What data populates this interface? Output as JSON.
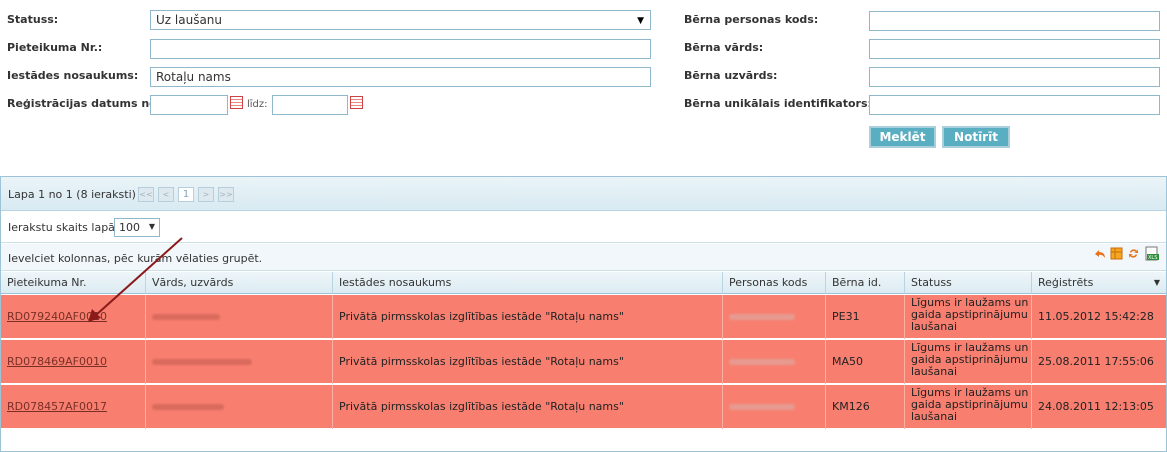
{
  "form": {
    "status_label": "Statuss:",
    "status_value": "Uz laušanu",
    "app_no_label": "Pieteikuma Nr.:",
    "app_no_value": "",
    "institution_label": "Iestādes nosaukums:",
    "institution_value": "Rotaļu nams",
    "reg_date_label": "Reģistrācijas datums no:",
    "reg_to_label": "līdz:",
    "child_code_label": "Bērna personas kods:",
    "child_name_label": "Bērna vārds:",
    "child_surname_label": "Bērna uzvārds:",
    "child_id_label": "Bērna unikālais identifikators:",
    "search_button": "Meklēt",
    "clear_button": "Notīrīt"
  },
  "pager": {
    "text": "Lapa 1 no 1 (8 ieraksti)",
    "current_page": "1",
    "per_page_label": "Ierakstu skaits lapā:",
    "per_page_value": "100"
  },
  "group_hint": "Ievelciet kolonnas, pēc kurām vēlaties grupēt.",
  "columns": [
    "Pieteikuma Nr.",
    "Vārds, uzvārds",
    "Iestādes nosaukums",
    "Personas kods",
    "Bērna id.",
    "Statuss",
    "Reģistrēts"
  ],
  "rows": [
    {
      "app_no": "RD079240AF0010",
      "institution": "Privātā pirmsskolas izglītības iestāde \"Rotaļu nams\"",
      "child_id": "PE31",
      "status": "Līgums ir laužams un gaida apstiprinājumu laušanai",
      "registered": "11.05.2012 15:42:28"
    },
    {
      "app_no": "RD078469AF0010",
      "institution": "Privātā pirmsskolas izglītības iestāde \"Rotaļu nams\"",
      "child_id": "MA50",
      "status": "Līgums ir laužams un gaida apstiprinājumu laušanai",
      "registered": "25.08.2011 17:55:06"
    },
    {
      "app_no": "RD078457AF0017",
      "institution": "Privātā pirmsskolas izglītības iestāde \"Rotaļu nams\"",
      "child_id": "KM126",
      "status": "Līgums ir laužams un gaida apstiprinājumu laušanai",
      "registered": "24.08.2011 12:13:05"
    }
  ],
  "colors": {
    "row_highlight": "#f87f70",
    "button": "#5aaec2",
    "annotation_arrow": "#8b1a1a"
  }
}
